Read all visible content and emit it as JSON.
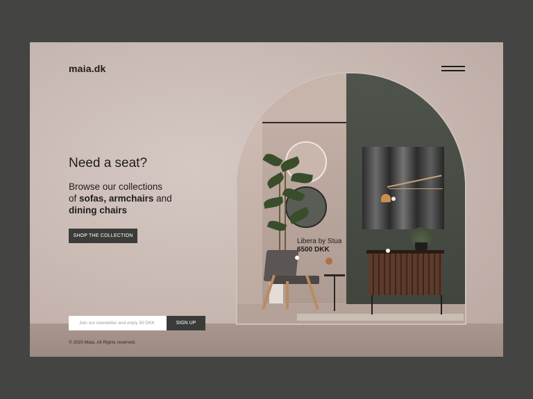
{
  "header": {
    "logo": "maia.dk",
    "menu_icon": "hamburger-icon"
  },
  "hero": {
    "headline": "Need a seat?",
    "sub_line1": "Browse our collections",
    "sub_of": "of",
    "sub_sofas": "sofas",
    "sub_comma": ",",
    "sub_armchairs": "armchairs",
    "sub_and": "and",
    "sub_dining": "dining chairs",
    "cta_label": "SHOP THE COLLECTION"
  },
  "product": {
    "name": "Libera by Stua",
    "price": "6500 DKK"
  },
  "newsletter": {
    "placeholder": "Join our newsletter and enjoy 50 DKK",
    "button_label": "SIGN UP"
  },
  "footer": {
    "copyright": "© 2020 Maia. All Rights reserved."
  },
  "colors": {
    "background": "#444542",
    "panel": "#c7b7b0",
    "button": "#3b3c3a",
    "text": "#1e1c1b"
  }
}
